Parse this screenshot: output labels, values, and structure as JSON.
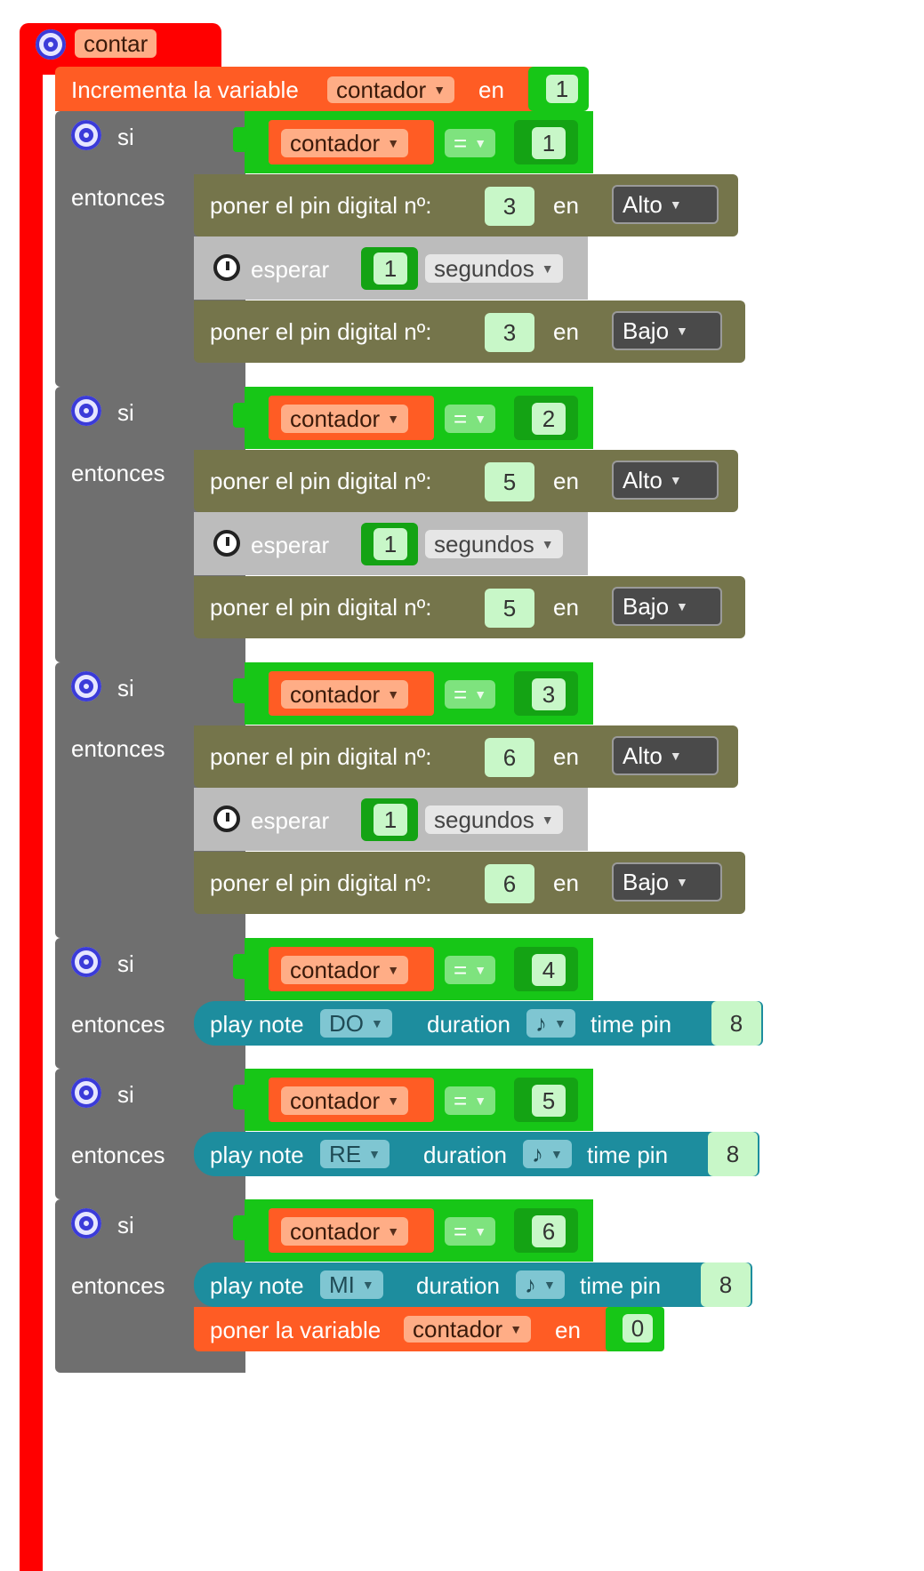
{
  "procedure": {
    "name": "contar"
  },
  "increment": {
    "label": "Incrementa la variable",
    "variable": "contador",
    "en": "en",
    "value": "1"
  },
  "common": {
    "si": "si",
    "entonces": "entonces",
    "eq": "=",
    "var": "contador",
    "pin_label": "poner el pin digital nº:",
    "en": "en",
    "wait_label": "esperar",
    "wait_value": "1",
    "wait_unit": "segundos",
    "alto": "Alto",
    "bajo": "Bajo",
    "play_note": "play note",
    "duration": "duration",
    "note_symbol": "♪",
    "time_pin": "time pin"
  },
  "if_blocks": [
    {
      "compare": "1",
      "pin": "3"
    },
    {
      "compare": "2",
      "pin": "5"
    },
    {
      "compare": "3",
      "pin": "6"
    },
    {
      "compare": "4",
      "note": "DO",
      "pin": "8"
    },
    {
      "compare": "5",
      "note": "RE",
      "pin": "8"
    },
    {
      "compare": "6",
      "note": "MI",
      "pin": "8"
    }
  ],
  "reset": {
    "label": "poner la variable",
    "variable": "contador",
    "en": "en",
    "value": "0"
  },
  "colors": {
    "procedure": "#ff0000",
    "if_block": "#6f6f6f",
    "logic": "#17c617",
    "variable": "#ff5c24",
    "pin_block": "#75754b",
    "wait_block": "#bcbcbc",
    "note_block": "#1d8d9e"
  }
}
